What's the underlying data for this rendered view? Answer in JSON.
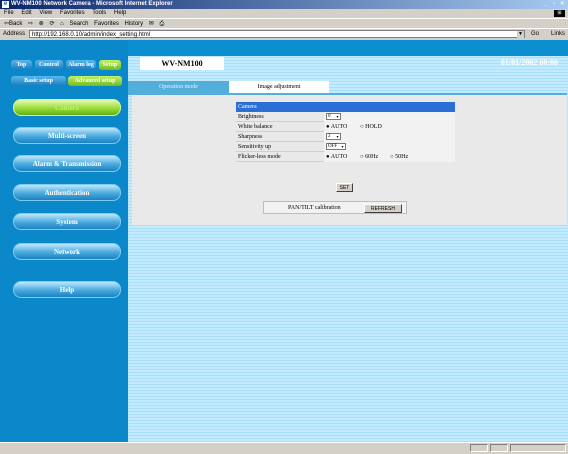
{
  "window": {
    "title": "WV-NM100 Network Camera - Microsoft Internet Explorer",
    "controls": "_ ▫ ×"
  },
  "menu": [
    "File",
    "Edit",
    "View",
    "Favorites",
    "Tools",
    "Help"
  ],
  "toolbar": {
    "back": "⇦Back",
    "forward": "⇨",
    "stop": "⊗",
    "refresh": "⟳",
    "home": "⌂",
    "search": "Search",
    "favorites": "Favorites",
    "history": "History",
    "mail": "✉",
    "print": "⎙"
  },
  "address": {
    "label": "Address",
    "url": "http://192.168.0.10/admin/index_setting.html",
    "go": "Go",
    "links": "Links"
  },
  "top_tabs": [
    "Top",
    "Control",
    "Alarm log",
    "Setup"
  ],
  "setup_tabs": [
    "Basic setup",
    "Advanced setup"
  ],
  "nav": [
    "Camera",
    "Multi-screen",
    "Alarm & Transmission",
    "Authentication",
    "System",
    "Network",
    "Help"
  ],
  "model": "WV-NM100",
  "datetime": "01/01/2002 00:00",
  "page_tabs": [
    "Operation mode",
    "Image adjustment"
  ],
  "camera": {
    "header": "Camera",
    "brightness": {
      "label": "Brightness",
      "value": "0"
    },
    "white_balance": {
      "label": "White balance",
      "options": [
        "AUTO",
        "HOLD"
      ],
      "selected": "AUTO"
    },
    "sharpness": {
      "label": "Sharpness",
      "value": "2"
    },
    "sensitivity_up": {
      "label": "Sensitivity up",
      "value": "OFF"
    },
    "flicker_less": {
      "label": "Flicker-less mode",
      "options": [
        "AUTO",
        "60Hz",
        "50Hz"
      ],
      "selected": "AUTO"
    },
    "set_button": "SET"
  },
  "pan_tilt": {
    "label": "PAN/TILT calibration",
    "button": "REFRESH"
  },
  "status": ""
}
